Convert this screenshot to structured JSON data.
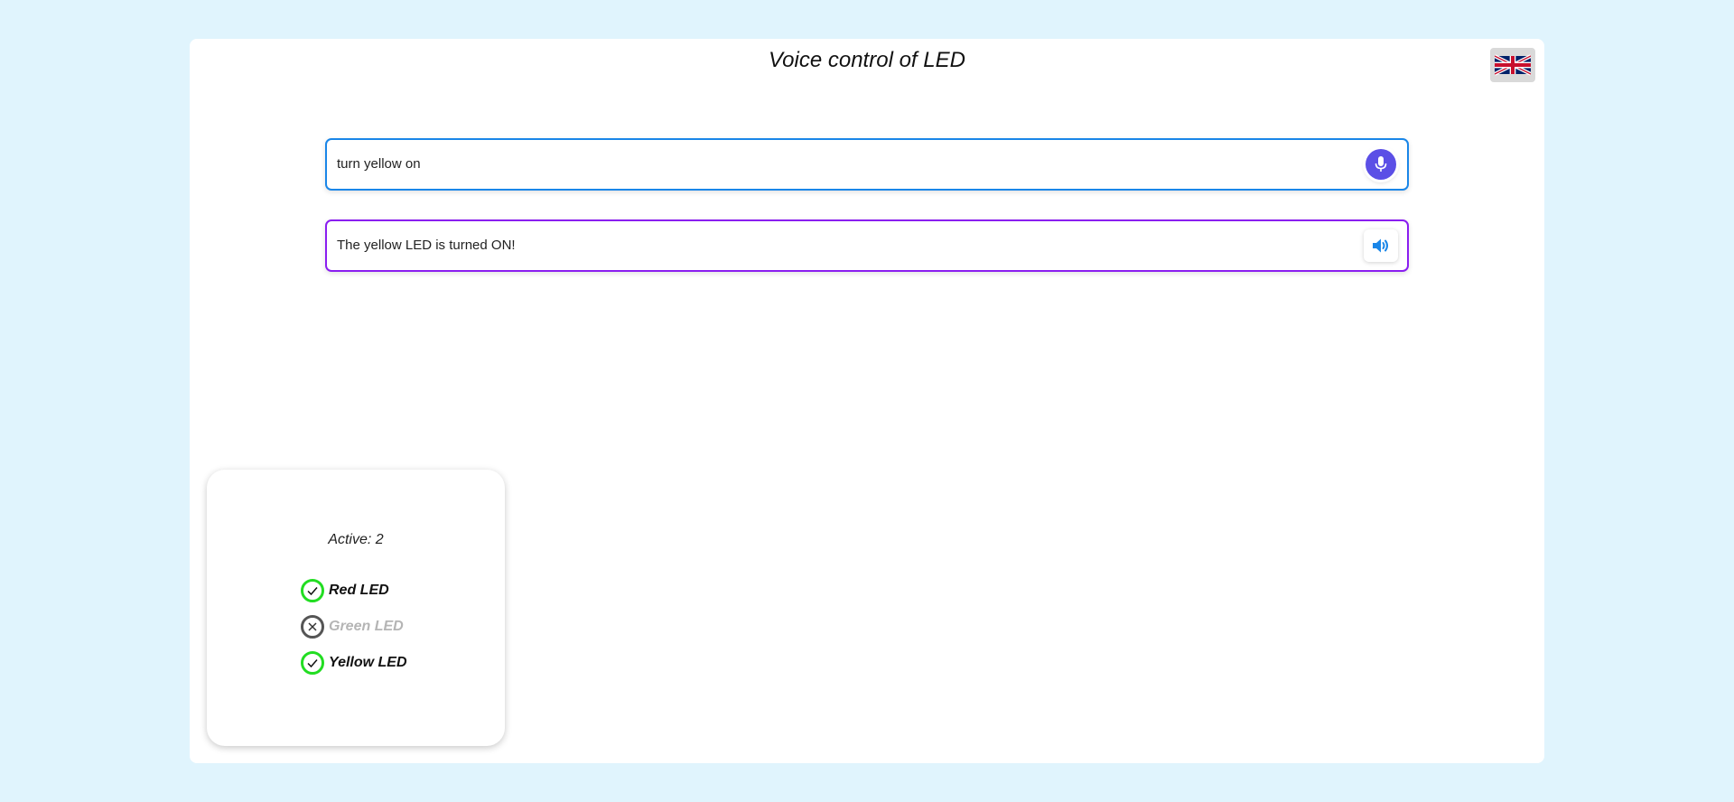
{
  "header": {
    "title": "Voice control of LED",
    "language_icon": "uk-flag-icon"
  },
  "query": {
    "value": "turn yellow on",
    "mic_icon": "microphone-icon"
  },
  "response": {
    "value": "The yellow LED is turned ON!",
    "speaker_icon": "speaker-icon"
  },
  "status": {
    "active_text": "Active: 2",
    "leds": [
      {
        "label": "Red LED",
        "state": "on",
        "icon": "check-icon"
      },
      {
        "label": "Green LED",
        "state": "off",
        "icon": "x-icon"
      },
      {
        "label": "Yellow LED",
        "state": "on",
        "icon": "check-icon"
      }
    ]
  },
  "colors": {
    "background": "#e0f4fd",
    "query_border": "#1a86e8",
    "response_border": "#8a1ef0",
    "mic_button": "#5b4fe6",
    "speaker_icon": "#1a86e8",
    "led_on": "#22dd22",
    "led_off": "#555555"
  }
}
